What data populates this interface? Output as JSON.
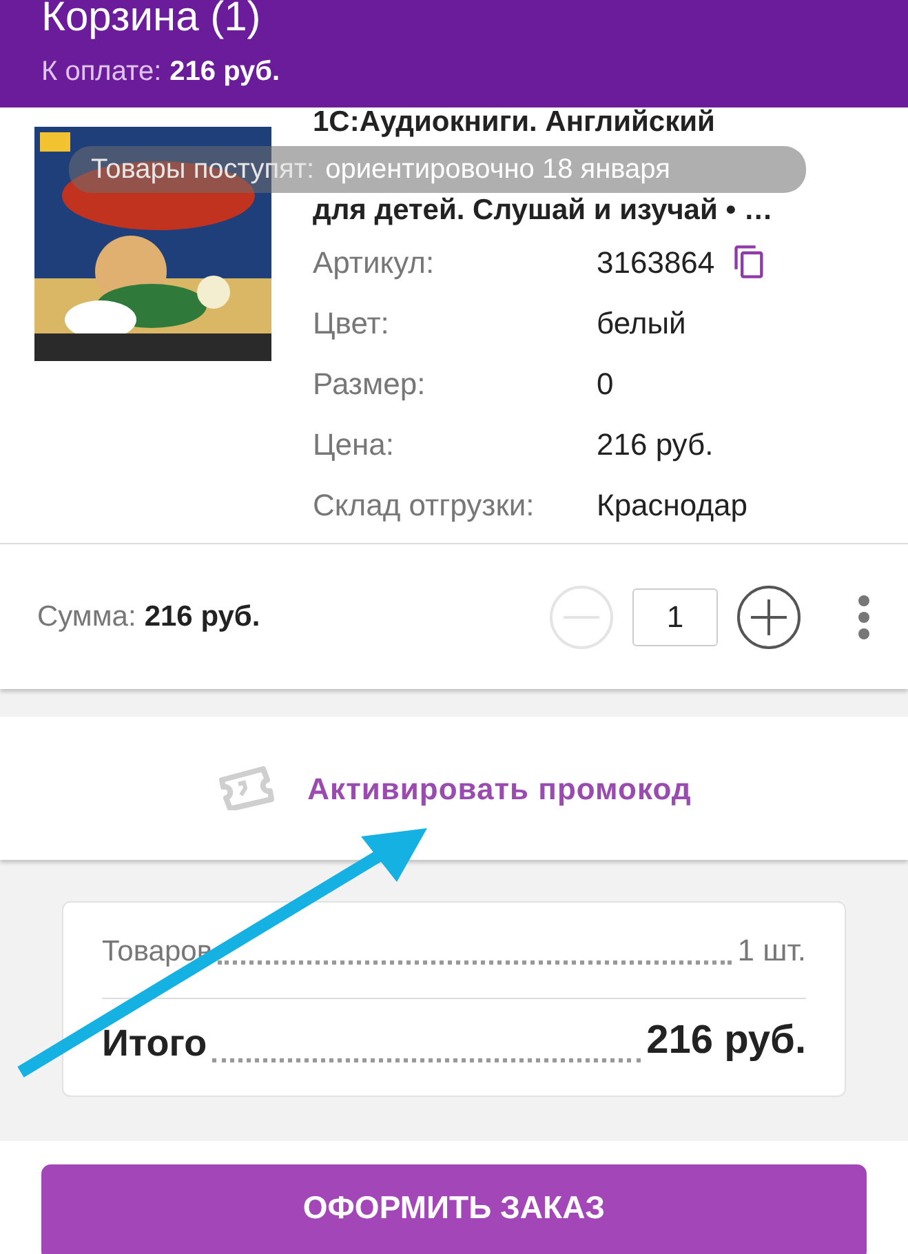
{
  "header": {
    "title": "Корзина (1)",
    "payment_label": "К оплате:",
    "payment_value": "216 руб."
  },
  "product": {
    "title_lines": [
      "1С:Аудиокниги. Английский",
      "для детей. Слушай и изучай • …"
    ],
    "details": [
      {
        "label": "Артикул:",
        "value": "3163864",
        "copyable": true
      },
      {
        "label": "Цвет:",
        "value": "белый",
        "copyable": false
      },
      {
        "label": "Размер:",
        "value": "0",
        "copyable": false
      },
      {
        "label": "Цена:",
        "value": "216 руб.",
        "copyable": false
      },
      {
        "label": "Склад отгрузки:",
        "value": "Краснодар",
        "copyable": false
      }
    ],
    "sum_label": "Сумма:",
    "sum_value": "216 руб.",
    "quantity": {
      "value": "1",
      "decrease_disabled": true,
      "increase_disabled": false
    }
  },
  "toast": {
    "label": "Товары поступят:",
    "value": "ориентировочно 18 января"
  },
  "promo": {
    "label": "Активировать промокод"
  },
  "summary": {
    "rows": [
      {
        "label": "Товаров",
        "value": "1 шт.",
        "kind": "normal"
      },
      {
        "label": "Итого",
        "value": "216 руб.",
        "kind": "total"
      }
    ]
  },
  "checkout_button": "ОФОРМИТЬ ЗАКАЗ"
}
